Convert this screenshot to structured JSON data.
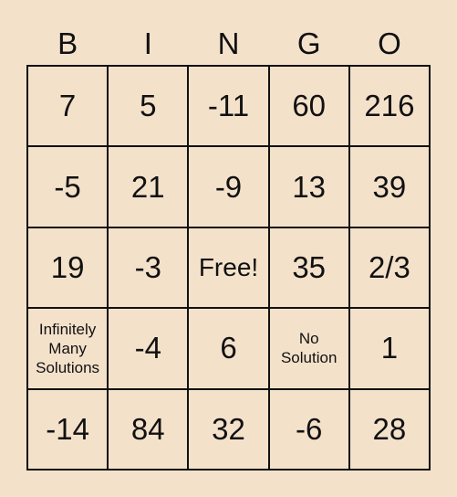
{
  "header": [
    "B",
    "I",
    "N",
    "G",
    "O"
  ],
  "cells": [
    [
      "7",
      "5",
      "-11",
      "60",
      "216"
    ],
    [
      "-5",
      "21",
      "-9",
      "13",
      "39"
    ],
    [
      "19",
      "-3",
      "Free!",
      "35",
      "2/3"
    ],
    [
      "Infinitely Many Solutions",
      "-4",
      "6",
      "No Solution",
      "1"
    ],
    [
      "-14",
      "84",
      "32",
      "-6",
      "28"
    ]
  ],
  "colors": {
    "background": "#f4e1ca",
    "lines": "#111111"
  }
}
